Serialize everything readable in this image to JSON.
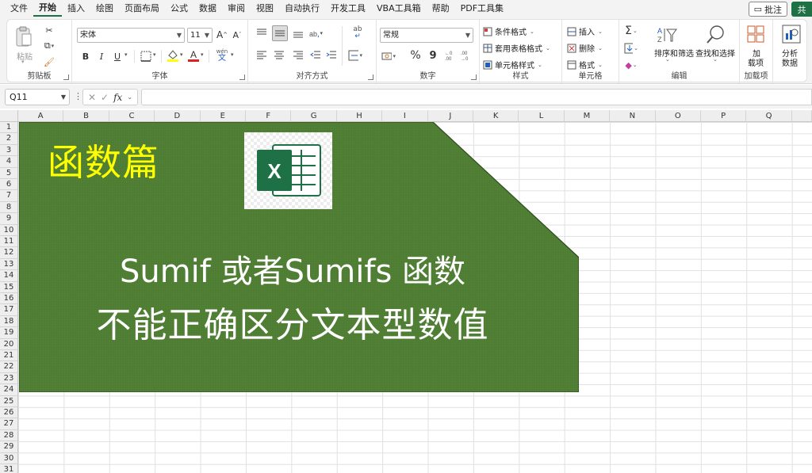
{
  "menu": {
    "items": [
      "文件",
      "开始",
      "插入",
      "绘图",
      "页面布局",
      "公式",
      "数据",
      "审阅",
      "视图",
      "自动执行",
      "开发工具",
      "VBA工具箱",
      "帮助",
      "PDF工具集"
    ],
    "active_index": 1,
    "comment_label": "批注",
    "share_label": "共"
  },
  "ribbon": {
    "clipboard": {
      "label": "剪贴板",
      "paste_label": "粘贴"
    },
    "font": {
      "label": "字体",
      "font_name": "宋体",
      "font_size": "11",
      "grow": "A^",
      "shrink": "A˅",
      "bold": "B",
      "italic": "I",
      "underline": "U",
      "phonetic_top": "wén",
      "phonetic_bottom": "文"
    },
    "alignment": {
      "label": "对齐方式",
      "wrap": "ab"
    },
    "number": {
      "label": "数字",
      "format": "常规",
      "percent": "%",
      "comma": "9"
    },
    "styles": {
      "label": "样式",
      "cond": "条件格式",
      "table": "套用表格格式",
      "cell": "单元格样式"
    },
    "cells": {
      "label": "单元格",
      "insert": "插入",
      "delete": "删除",
      "format": "格式"
    },
    "editing": {
      "label": "编辑",
      "sort": "排序和筛选",
      "find": "查找和选择"
    },
    "addins": {
      "label": "加载项",
      "btn_top": "加",
      "btn_bottom": "载项"
    },
    "analysis": {
      "btn_top": "分析",
      "btn_bottom": "数据"
    }
  },
  "formula_bar": {
    "name_box": "Q11",
    "fx": "fx",
    "value": ""
  },
  "sheet": {
    "columns": [
      "A",
      "B",
      "C",
      "D",
      "E",
      "F",
      "G",
      "H",
      "I",
      "J",
      "K",
      "L",
      "M",
      "N",
      "O",
      "P",
      "Q"
    ],
    "rows": [
      "1",
      "2",
      "3",
      "4",
      "5",
      "6",
      "7",
      "8",
      "9",
      "10",
      "11",
      "12",
      "13",
      "14",
      "15",
      "16",
      "17",
      "18",
      "19",
      "20",
      "21",
      "22",
      "23",
      "24",
      "25",
      "26",
      "27",
      "28",
      "29",
      "30",
      "31"
    ]
  },
  "banner": {
    "tag": "函数篇",
    "line1": "Sumif 或者Sumifs 函数",
    "line2": "不能正确区分文本型数值",
    "fill_color": "#4e7d33",
    "tag_color": "#ffff00",
    "logo_letter": "X",
    "logo_color": "#1e7145"
  }
}
